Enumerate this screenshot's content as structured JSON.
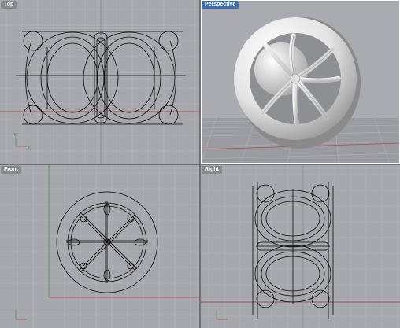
{
  "viewports": {
    "top": {
      "label": "Top",
      "active": false
    },
    "perspective": {
      "label": "Perspective",
      "active": true
    },
    "front": {
      "label": "Front",
      "active": false
    },
    "right": {
      "label": "Right",
      "active": false
    }
  },
  "axis_labels": {
    "x": "x",
    "y": "y",
    "z": "z"
  },
  "colors": {
    "viewport_bg": "#a6a8ad",
    "grid_minor": "#b3b5ba",
    "grid_major": "#999ba0",
    "x_axis": "#a05252",
    "y_axis": "#4d9a4d",
    "wireframe": "#0a0a0a",
    "perspective_ground": "#8f9196",
    "perspective_sky": "#a9abb0",
    "model_shading": "#e6e6e6",
    "active_label": "#3d6fb0"
  }
}
